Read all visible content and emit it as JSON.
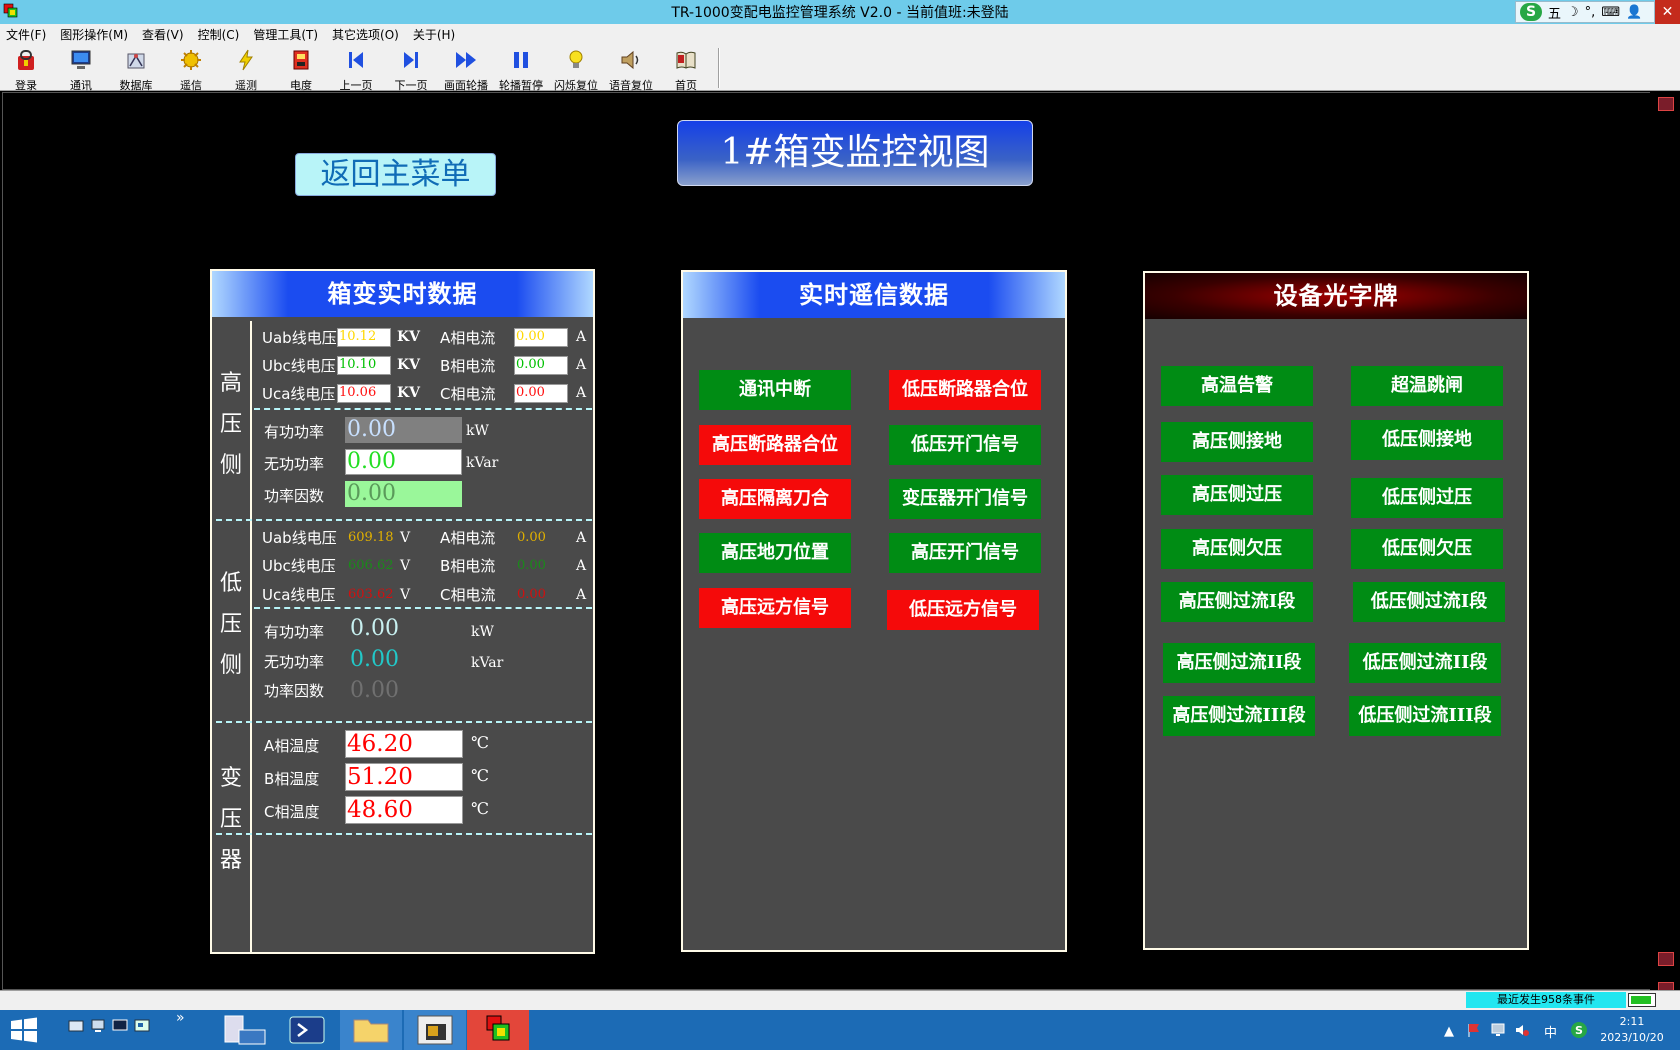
{
  "window": {
    "title": "TR-1000变配电监控管理系统 V2.0 - 当前值班:未登陆",
    "close_glyph": "✕",
    "ime": {
      "logo": "S",
      "mode": "五",
      "items": [
        "☽",
        "°,",
        "⌨",
        "👤"
      ]
    }
  },
  "menu": [
    "文件(F)",
    "图形操作(M)",
    "查看(V)",
    "控制(C)",
    "管理工具(T)",
    "其它选项(O)",
    "关于(H)"
  ],
  "toolbar": [
    {
      "label": "登录",
      "icon": "login-icon"
    },
    {
      "label": "通讯",
      "icon": "monitor-icon"
    },
    {
      "label": "数据库",
      "icon": "database-icon"
    },
    {
      "label": "遥信",
      "icon": "signal-icon"
    },
    {
      "label": "遥测",
      "icon": "lightning-icon"
    },
    {
      "label": "电度",
      "icon": "meter-icon"
    },
    {
      "label": "上一页",
      "icon": "previous-page-icon"
    },
    {
      "label": "下一页",
      "icon": "next-page-icon"
    },
    {
      "label": "画面轮播",
      "icon": "fast-forward-icon"
    },
    {
      "label": "轮播暂停",
      "icon": "pause-icon"
    },
    {
      "label": "闪烁复位",
      "icon": "bulb-icon"
    },
    {
      "label": "语音复位",
      "icon": "speaker-icon"
    },
    {
      "label": "首页",
      "icon": "home-book-icon"
    }
  ],
  "screen": {
    "back_button": "返回主菜单",
    "title": "1#箱变监控视图"
  },
  "realtime": {
    "header": "箱变实时数据",
    "hv": {
      "side": [
        "高",
        "压",
        "侧"
      ],
      "uab_label": "Uab线电压",
      "uab_value": "10.12",
      "ubc_label": "Ubc线电压",
      "ubc_value": "10.10",
      "uca_label": "Uca线电压",
      "uca_value": "10.06",
      "v_unit": "KV",
      "ia_label": "A相电流",
      "ia_value": "0.00",
      "ib_label": "B相电流",
      "ib_value": "0.00",
      "ic_label": "C相电流",
      "ic_value": "0.00",
      "i_unit": "A",
      "p_label": "有功功率",
      "p_value": "0.00",
      "p_unit": "kW",
      "q_label": "无功功率",
      "q_value": "0.00",
      "q_unit": "kVar",
      "pf_label": "功率因数",
      "pf_value": "0.00"
    },
    "lv": {
      "side": [
        "低",
        "压",
        "侧"
      ],
      "uab_label": "Uab线电压",
      "uab_value": "609.18",
      "ubc_label": "Ubc线电压",
      "ubc_value": "606.62",
      "uca_label": "Uca线电压",
      "uca_value": "603.62",
      "v_unit": "V",
      "ia_label": "A相电流",
      "ia_value": "0.00",
      "ib_label": "B相电流",
      "ib_value": "0.00",
      "ic_label": "C相电流",
      "ic_value": "0.00",
      "i_unit": "A",
      "p_label": "有功功率",
      "p_value": "0.00",
      "p_unit": "kW",
      "q_label": "无功功率",
      "q_value": "0.00",
      "q_unit": "kVar",
      "pf_label": "功率因数",
      "pf_value": "0.00"
    },
    "tr": {
      "side": [
        "变",
        "压",
        "器"
      ],
      "ta_label": "A相温度",
      "ta_value": "46.20",
      "tb_label": "B相温度",
      "tb_value": "51.20",
      "tc_label": "C相温度",
      "tc_value": "48.60",
      "t_unit": "℃"
    }
  },
  "remote_signal": {
    "header": "实时遥信数据",
    "buttons": [
      {
        "label": "通讯中断",
        "state": "green"
      },
      {
        "label": "低压断路器合位",
        "state": "red"
      },
      {
        "label": "高压断路器合位",
        "state": "red"
      },
      {
        "label": "低压开门信号",
        "state": "green"
      },
      {
        "label": "高压隔离刀合",
        "state": "red"
      },
      {
        "label": "变压器开门信号",
        "state": "green"
      },
      {
        "label": "高压地刀位置",
        "state": "green"
      },
      {
        "label": "高压开门信号",
        "state": "green"
      },
      {
        "label": "高压远方信号",
        "state": "red"
      },
      {
        "label": "低压远方信号",
        "state": "red"
      }
    ]
  },
  "annunciator": {
    "header": "设备光字牌",
    "buttons": [
      {
        "label": "高温告警",
        "state": "green"
      },
      {
        "label": "超温跳闸",
        "state": "green"
      },
      {
        "label": "高压侧接地",
        "state": "green"
      },
      {
        "label": "低压侧接地",
        "state": "green"
      },
      {
        "label": "高压侧过压",
        "state": "green"
      },
      {
        "label": "低压侧过压",
        "state": "green"
      },
      {
        "label": "高压侧欠压",
        "state": "green"
      },
      {
        "label": "低压侧欠压",
        "state": "green"
      },
      {
        "label": "高压侧过流I段",
        "state": "green"
      },
      {
        "label": "低压侧过流I段",
        "state": "green"
      },
      {
        "label": "高压侧过流II段",
        "state": "green"
      },
      {
        "label": "低压侧过流II段",
        "state": "green"
      },
      {
        "label": "高压侧过流III段",
        "state": "green"
      },
      {
        "label": "低压侧过流III段",
        "state": "green"
      }
    ]
  },
  "status": {
    "events": "最近发生958条事件"
  },
  "taskbar": {
    "time": "2:11",
    "date": "2023/10/20",
    "ime_label": "中",
    "chevron": "»",
    "tray_arrow": "▲"
  },
  "colors": {
    "green_signal": "#008c14",
    "red_signal": "#f50a0a",
    "hv_uab": "#ffd800",
    "hv_ubc": "#00c000",
    "hv_uca": "#ff1010",
    "lv_uab": "#e0b000",
    "lv_ubc": "#1a8a1a",
    "lv_uca": "#d01010",
    "temp": "#ff0000"
  }
}
